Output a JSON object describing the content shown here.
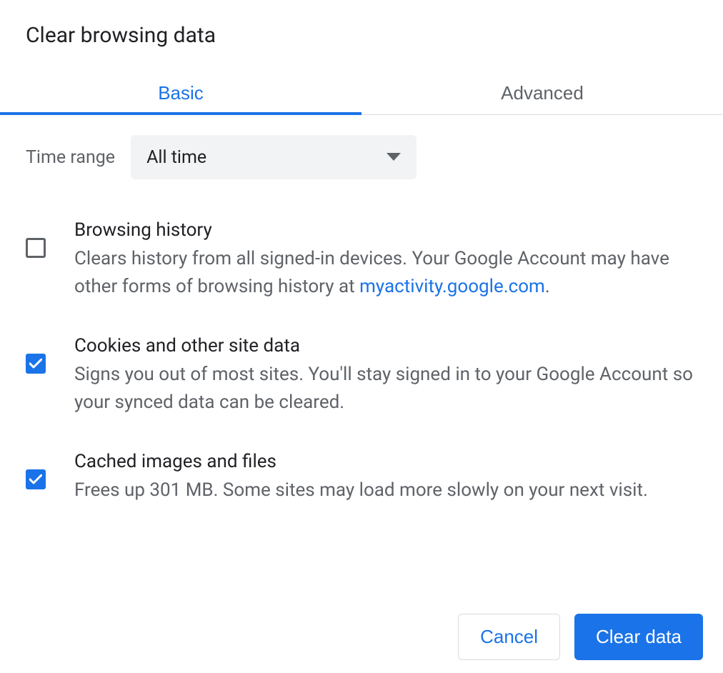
{
  "dialog": {
    "title": "Clear browsing data"
  },
  "tabs": {
    "basic": "Basic",
    "advanced": "Advanced",
    "active": "basic"
  },
  "timeRange": {
    "label": "Time range",
    "value": "All time"
  },
  "options": [
    {
      "key": "browsing-history",
      "checked": false,
      "title": "Browsing history",
      "desc_pre": "Clears history from all signed-in devices. Your Google Account may have other forms of browsing history at ",
      "link_text": "myactivity.google.com",
      "desc_post": "."
    },
    {
      "key": "cookies",
      "checked": true,
      "title": "Cookies and other site data",
      "desc_pre": "Signs you out of most sites. You'll stay signed in to your Google Account so your synced data can be cleared.",
      "link_text": "",
      "desc_post": ""
    },
    {
      "key": "cached",
      "checked": true,
      "title": "Cached images and files",
      "desc_pre": "Frees up 301 MB. Some sites may load more slowly on your next visit.",
      "link_text": "",
      "desc_post": ""
    }
  ],
  "buttons": {
    "cancel": "Cancel",
    "confirm": "Clear data"
  }
}
